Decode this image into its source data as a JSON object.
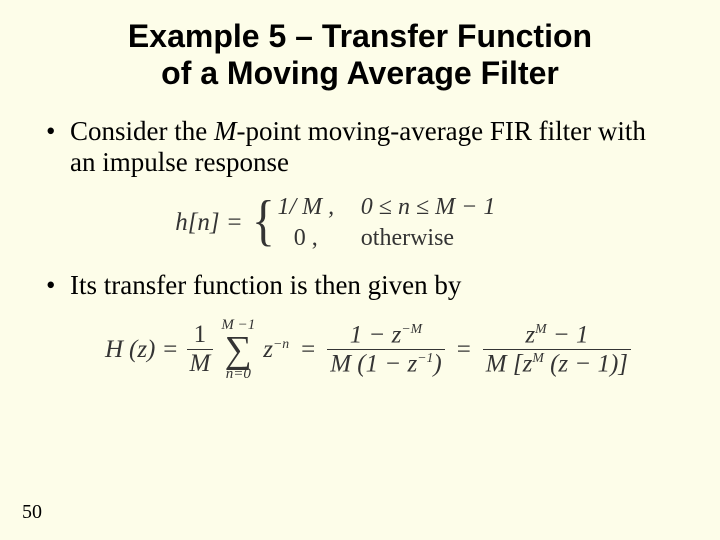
{
  "title_line1": "Example 5 – Transfer Function",
  "title_line2": "of a Moving Average Filter",
  "bullet1_pre": "Consider the ",
  "bullet1_M": "M",
  "bullet1_post": "-point moving-average FIR filter with an impulse response",
  "bullet2": "Its transfer function is then given by",
  "page_number": "50",
  "hn": {
    "lhs": "h[n] =",
    "case1_val": "1/ M ,",
    "case1_cond": "0 ≤ n ≤ M − 1",
    "case2_val": "0 ,",
    "case2_cond": "otherwise"
  },
  "hz": {
    "lhs_H": "H",
    "lhs_z": "(z) =",
    "frac1_num": "1",
    "frac1_den": "M",
    "sum_top": "M −1",
    "sum_bot": "n=0",
    "term_z": "z",
    "term_exp_neg_n": "−n",
    "eq": "=",
    "frac2_num_pre": "1 − z",
    "frac2_num_exp": "−M",
    "frac2_den_pre": "M (1 − z",
    "frac2_den_exp": "−1",
    "frac2_den_post": ")",
    "frac3_num_pre": "z",
    "frac3_num_exp": "M",
    "frac3_num_post": " − 1",
    "frac3_den_pre": "M [z",
    "frac3_den_exp": "M",
    "frac3_den_post": " (z − 1)]"
  }
}
